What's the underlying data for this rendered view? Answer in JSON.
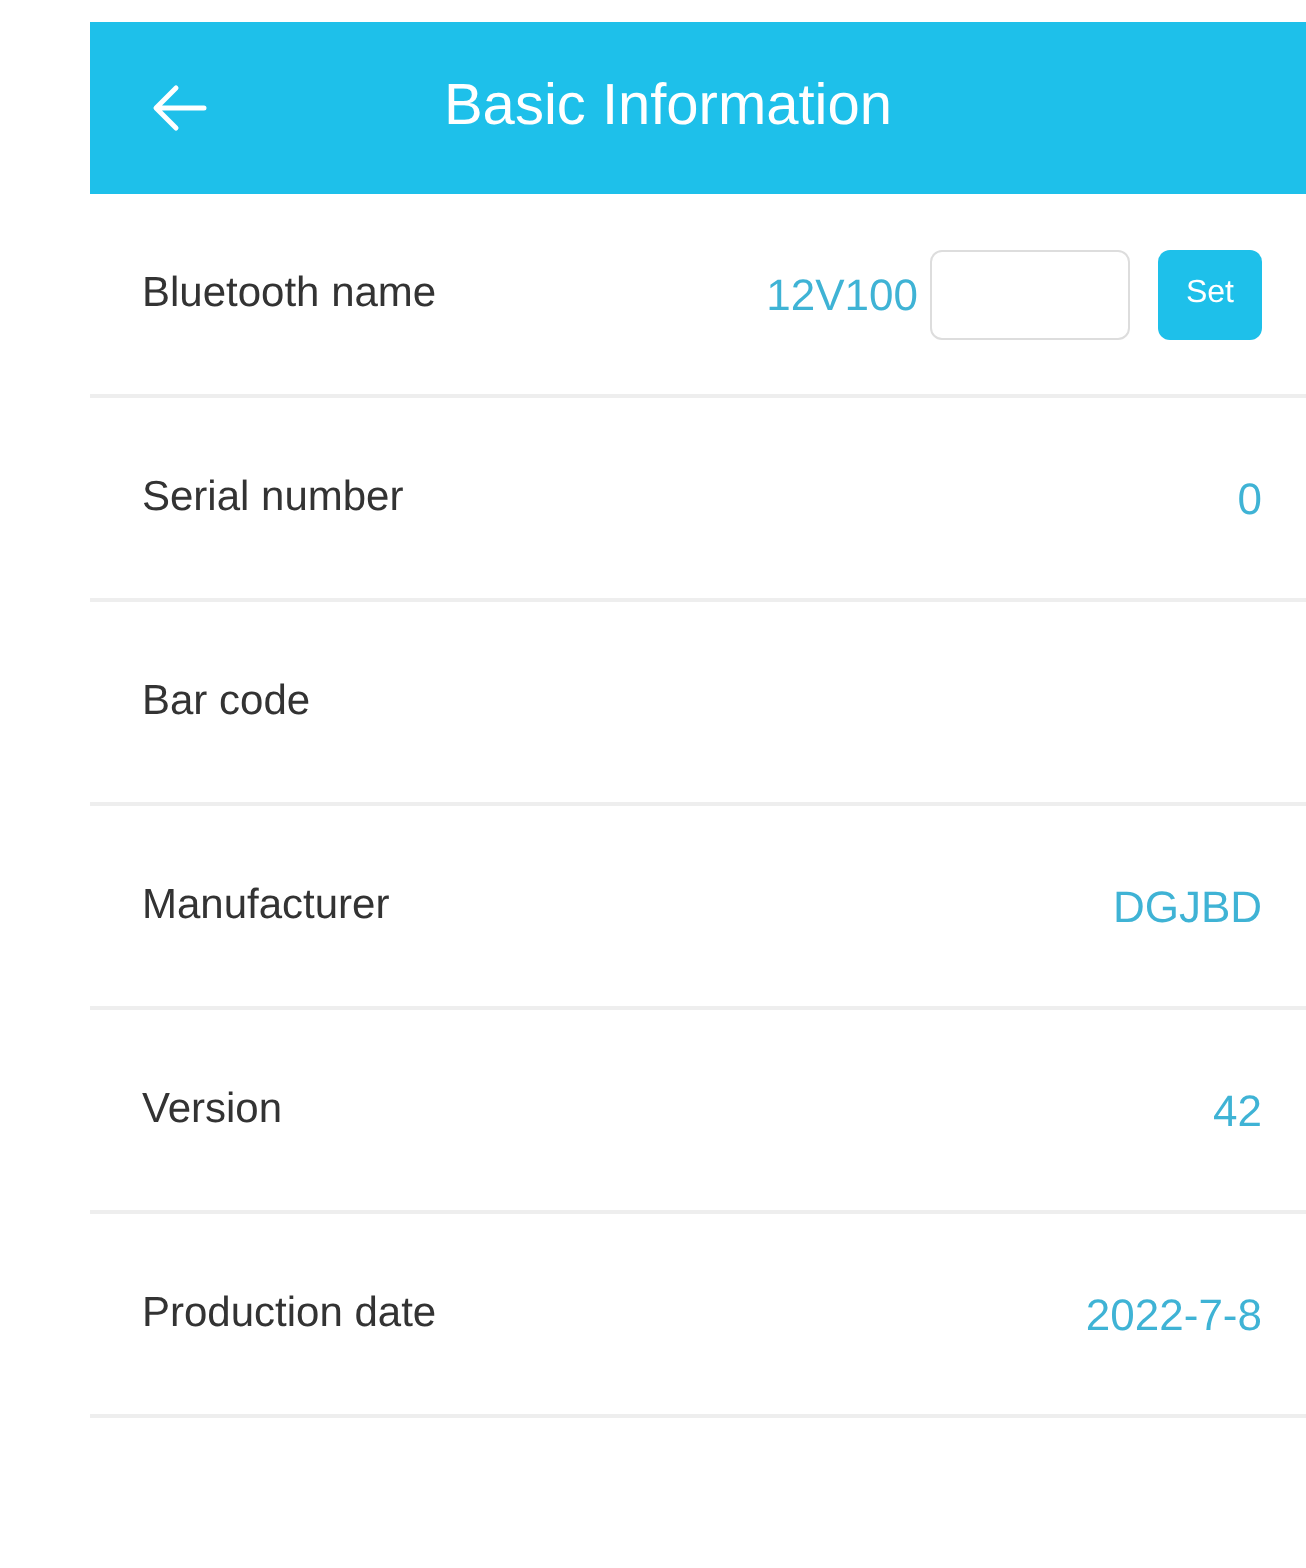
{
  "header": {
    "title": "Basic Information"
  },
  "rows": [
    {
      "kind": "editable",
      "label": "Bluetooth name",
      "value": "12V100",
      "button": "Set"
    },
    {
      "kind": "text",
      "label": "Serial number",
      "value": "0"
    },
    {
      "kind": "text",
      "label": "Bar code"
    },
    {
      "kind": "text",
      "label": "Manufacturer",
      "value": "DGJBD"
    },
    {
      "kind": "text",
      "label": "Version",
      "value": "42"
    },
    {
      "kind": "text",
      "label": "Production date",
      "value": "2022-7-8"
    }
  ]
}
